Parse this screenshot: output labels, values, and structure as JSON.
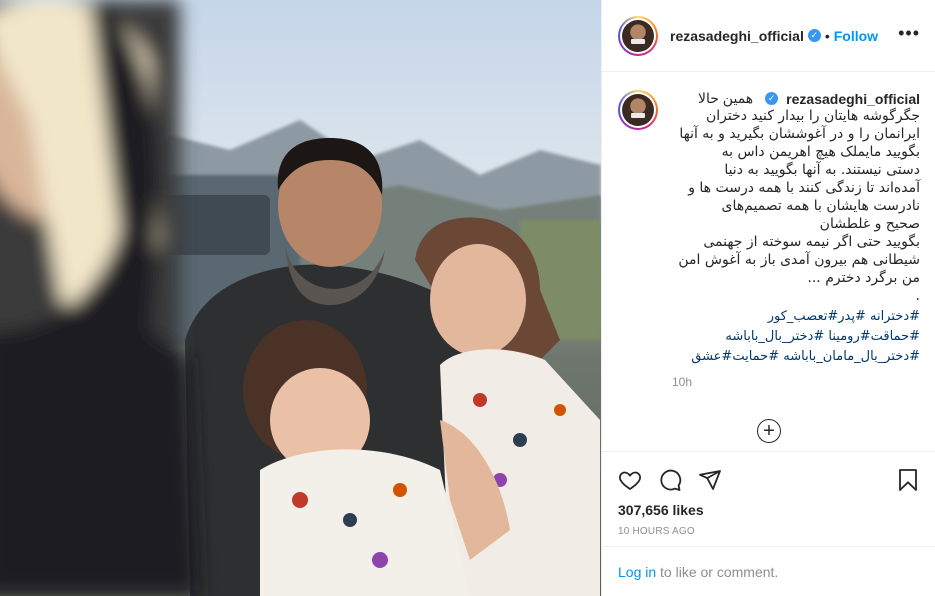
{
  "post": {
    "photo_alt": "Post photo",
    "username": "rezasadeghi_official",
    "follow_label": "Follow",
    "more_label": "•••"
  },
  "caption": {
    "username": "rezasadeghi_official",
    "first_line": "همین حالا",
    "lines": [
      "جگرگوشه هایتان را بیدار کنید دختران",
      "ایرانمان را و در آغوششان بگیرید و به آنها",
      "بگویید مایملک هیچ اهریمن داس به",
      "دستی نیستند. به آنها بگویید به دنیا",
      "آمده‌اند تا زندگی کنند با همه درست ها و",
      "نادرست هایشان با همه تصمیم‌های",
      "صحیح و غلطشان",
      "بگویید حتی اگر نیمه سوخته از جهنمی",
      "شیطانی هم بیرون آمدی باز به آغوش امن",
      "من برگرد دخترم ...",
      "."
    ],
    "hashtag_lines": [
      "#دخترانه #پدر#تعصب_کور",
      "#حماقت#رومینا #دختر_بال_باباشه",
      "#دختر_بال_مامان_باباشه #حمایت#عشق"
    ],
    "time": "10h"
  },
  "load_more_label": "+",
  "actions": {
    "like_icon": "heart-icon",
    "comment_icon": "comment-bubble-icon",
    "share_icon": "paper-plane-icon",
    "save_icon": "bookmark-icon"
  },
  "likes_text": "307,656 likes",
  "post_time": "10 HOURS AGO",
  "login": {
    "link_text": "Log in",
    "rest_text": " to like or comment."
  },
  "colors": {
    "link_blue": "#0095f6",
    "hashtag_blue": "#00376b",
    "verified_blue": "#3897f0",
    "muted_gray": "#8e8e8e",
    "text": "#262626"
  }
}
